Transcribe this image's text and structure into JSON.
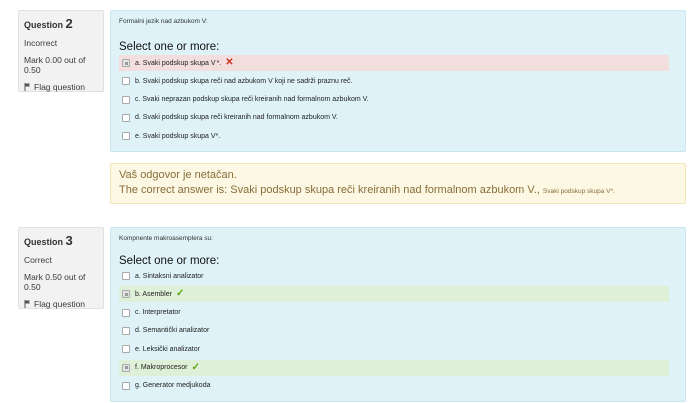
{
  "question2": {
    "label": "Question",
    "number": "2",
    "state": "Incorrect",
    "grade": "Mark 0.00 out of 0.50",
    "flag": "Flag question",
    "qtext": "Formalni jezik nad azbukom V:",
    "prompt": "Select one or more:",
    "answers": [
      {
        "label": "a. Svaki podskup skupa V",
        "suffix": "*.",
        "checked": true,
        "status": "incorrect",
        "mark": "✕"
      },
      {
        "label": "b. Svaki podskup skupa reči nad azbukom V koji ne sadrži praznu reč.",
        "suffix": "",
        "checked": false,
        "status": "",
        "mark": ""
      },
      {
        "label": "c. Svaki neprazan podskup skupa reči kreiranih nad formalnom azbukom V.",
        "suffix": "",
        "checked": false,
        "status": "",
        "mark": ""
      },
      {
        "label": "d. Svaki podskup skupa reči kreiranih nad formalnom azbukom V.",
        "suffix": "",
        "checked": false,
        "status": "",
        "mark": ""
      },
      {
        "label": "e. Svaki podskup skupa V*.",
        "suffix": "",
        "checked": false,
        "status": "",
        "mark": ""
      }
    ]
  },
  "feedback": {
    "line1": "Vaš odgovor je netačan.",
    "line2": "The correct answer is: Svaki podskup skupa reči kreiranih nad formalnom azbukom V.,",
    "line2_small": "Svaki podskup skupa V*."
  },
  "question3": {
    "label": "Question",
    "number": "3",
    "state": "Correct",
    "grade": "Mark 0.50 out of 0.50",
    "flag": "Flag question",
    "qtext": "Kompnente makroasemplera su:",
    "prompt": "Select one or more:",
    "answers": [
      {
        "label": "a. Sintaksni analizator",
        "checked": false,
        "status": "",
        "mark": ""
      },
      {
        "label": "b. Asembler",
        "checked": true,
        "status": "correct",
        "mark": "✓"
      },
      {
        "label": "c. Interpretator",
        "checked": false,
        "status": "",
        "mark": ""
      },
      {
        "label": "d. Semantički analizator",
        "checked": false,
        "status": "",
        "mark": ""
      },
      {
        "label": "e. Leksički analizator",
        "checked": false,
        "status": "",
        "mark": ""
      },
      {
        "label": "f. Makroprocesor",
        "checked": true,
        "status": "correct",
        "mark": "✓"
      },
      {
        "label": "g. Generator medjukoda",
        "checked": false,
        "status": "",
        "mark": ""
      }
    ]
  }
}
